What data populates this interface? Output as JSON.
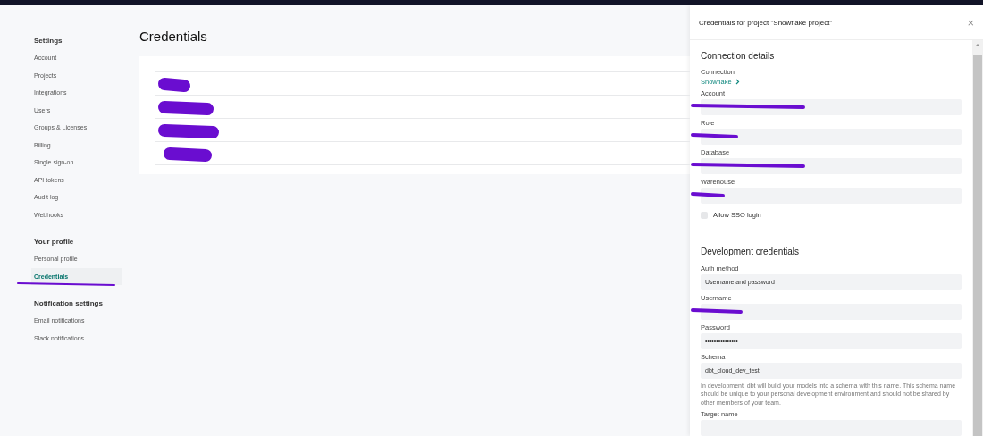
{
  "sidebar": {
    "sections": [
      {
        "heading": "Settings",
        "items": [
          {
            "label": "Account",
            "selected": false
          },
          {
            "label": "Projects",
            "selected": false
          },
          {
            "label": "Integrations",
            "selected": false
          },
          {
            "label": "Users",
            "selected": false
          },
          {
            "label": "Groups & Licenses",
            "selected": false
          },
          {
            "label": "Billing",
            "selected": false
          },
          {
            "label": "Single sign-on",
            "selected": false
          },
          {
            "label": "API tokens",
            "selected": false
          },
          {
            "label": "Audit log",
            "selected": false
          },
          {
            "label": "Webhooks",
            "selected": false
          }
        ]
      },
      {
        "heading": "Your profile",
        "items": [
          {
            "label": "Personal profile",
            "selected": false
          },
          {
            "label": "Credentials",
            "selected": true,
            "underlined": true
          }
        ]
      },
      {
        "heading": "Notification settings",
        "items": [
          {
            "label": "Email notifications",
            "selected": false
          },
          {
            "label": "Slack notifications",
            "selected": false
          }
        ]
      }
    ]
  },
  "page": {
    "title": "Credentials",
    "rows": [
      {
        "redacted": true
      },
      {
        "redacted": true
      },
      {
        "redacted": true
      },
      {
        "redacted": true
      }
    ]
  },
  "panel": {
    "title": "Credentials for project \"Snowflake project\"",
    "close": "×",
    "sections": [
      {
        "heading": "Connection details",
        "fields": [
          {
            "kind": "link",
            "label": "Connection",
            "value": "Snowflake"
          },
          {
            "kind": "input",
            "label": "Account",
            "redacted": true
          },
          {
            "kind": "input",
            "label": "Role",
            "redacted": true
          },
          {
            "kind": "input",
            "label": "Database",
            "redacted": true
          },
          {
            "kind": "input",
            "label": "Warehouse",
            "redacted": true
          },
          {
            "kind": "checkbox",
            "label": "Allow SSO login",
            "checked": false
          }
        ]
      },
      {
        "heading": "Development credentials",
        "fields": [
          {
            "kind": "input",
            "label": "Auth method",
            "value": "Username and password"
          },
          {
            "kind": "input",
            "label": "Username",
            "redacted": true
          },
          {
            "kind": "input",
            "label": "Password",
            "value": "•••••••••••••••"
          },
          {
            "kind": "input",
            "label": "Schema",
            "value": "dbt_cloud_dev_test",
            "help": "In development, dbt will build your models into a schema with this name. This schema name should be unique to your personal development environment and should not be shared by other members of your team."
          },
          {
            "kind": "input",
            "label": "Target name"
          }
        ]
      }
    ]
  }
}
